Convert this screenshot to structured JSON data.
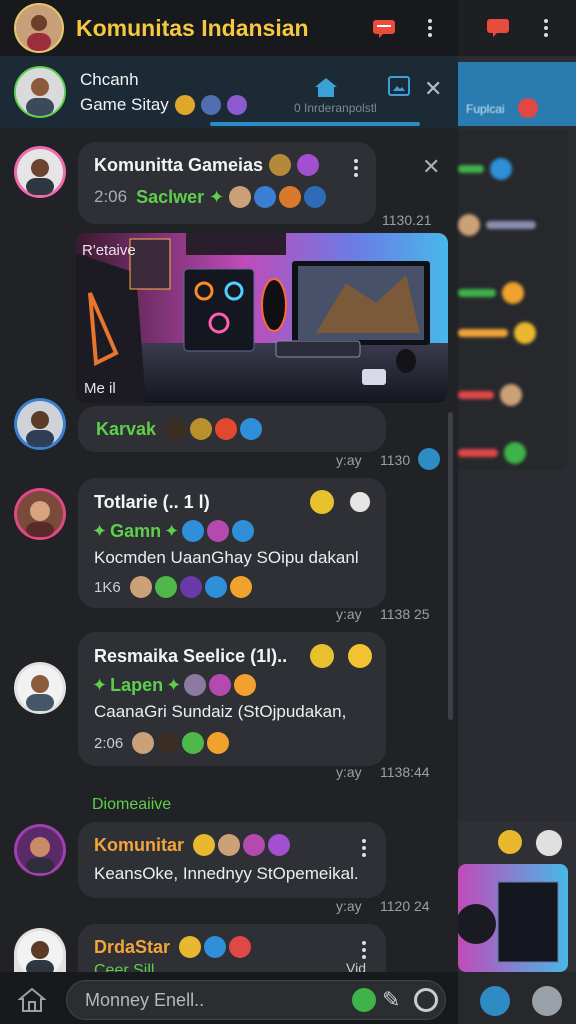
{
  "app": {
    "title": "Komunitas Indansian"
  },
  "pinned": {
    "name": "Chcanh",
    "line2": "Game Sitay",
    "subtitle": "0 Inrderanpolstl"
  },
  "messages": [
    {
      "name": "Komunitta Gameias",
      "time_prefix": "2:06",
      "green_text": "Saclwer",
      "time": "1130.21"
    },
    {
      "photo_caption_top": "R'etaive",
      "photo_caption_bottom": "Me il"
    },
    {
      "green_text": "Karvak",
      "meta": "y:ay",
      "time": "1130"
    },
    {
      "name": "Totlarie (.. 1 l)",
      "green_text": "Gamn",
      "body": "Kocmden UaanGhay SOipu dakanl",
      "counter": "1K6",
      "meta": "y:ay",
      "time": "1138 25"
    },
    {
      "name": "Resmaika Seelice (1l)..",
      "green_text": "Lapen",
      "body": "CaanaGri Sundaiz (StOjpudakan,",
      "counter": "2:06",
      "meta": "y:ay",
      "time": "1138:44"
    },
    {
      "date_sep": "Diomeaiive"
    },
    {
      "orange_text": "Komunitar",
      "body": "KeansOke, Innednyy StOpemeikal.",
      "meta": "y:ay",
      "time": "1120 24"
    },
    {
      "orange_text": "DrdaStar",
      "cut_text": "Ceer Sill",
      "side_text": "Vid"
    }
  ],
  "input": {
    "placeholder": "Monney Enell.."
  },
  "side": {
    "strip_text": "Fuplcai"
  },
  "colors": {
    "accent": "#f5c842",
    "green": "#5fce4b",
    "orange": "#f3a43a",
    "blue": "#2e8bc4"
  }
}
